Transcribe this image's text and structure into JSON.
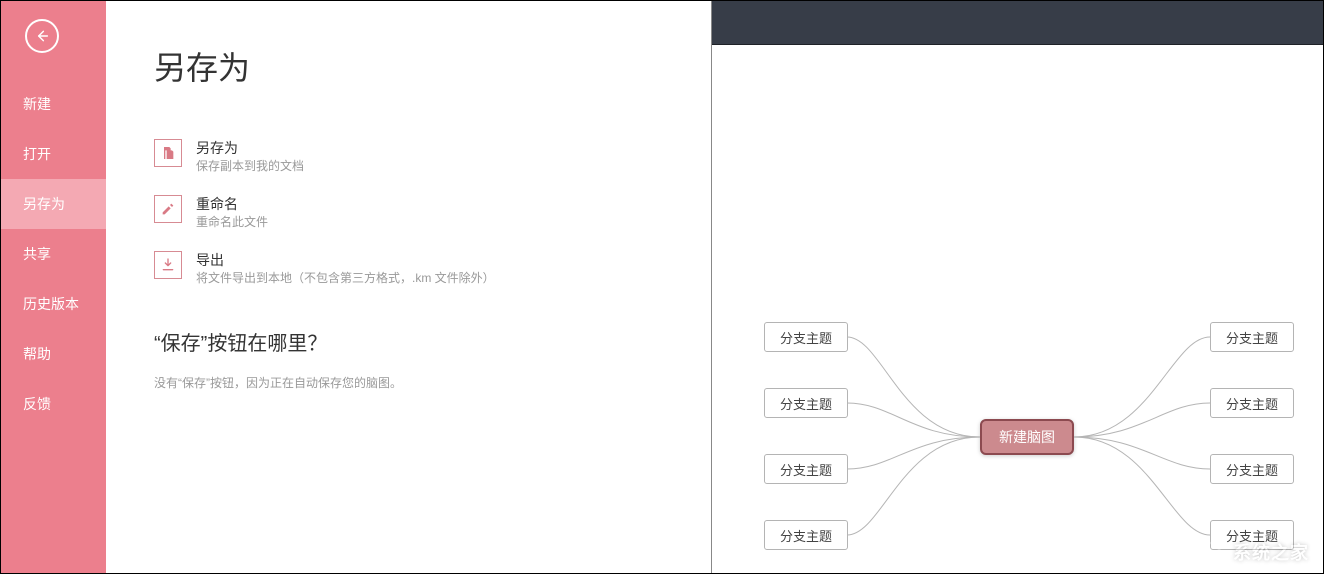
{
  "sidebar": {
    "items": [
      {
        "label": "新建"
      },
      {
        "label": "打开"
      },
      {
        "label": "另存为",
        "active": true
      },
      {
        "label": "共享"
      },
      {
        "label": "历史版本"
      },
      {
        "label": "帮助"
      },
      {
        "label": "反馈"
      }
    ]
  },
  "page": {
    "title": "另存为",
    "actions": [
      {
        "title": "另存为",
        "desc": "保存副本到我的文档"
      },
      {
        "title": "重命名",
        "desc": "重命名此文件"
      },
      {
        "title": "导出",
        "desc": "将文件导出到本地（不包含第三方格式，.km 文件除外）"
      }
    ],
    "section_title": "“保存”按钮在哪里？",
    "section_desc": "没有“保存”按钮，因为正在自动保存您的脑图。"
  },
  "mindmap": {
    "central": "新建脑图",
    "branches_left": [
      "分支主题",
      "分支主题",
      "分支主题",
      "分支主题"
    ],
    "branches_right": [
      "分支主题",
      "分支主题",
      "分支主题",
      "分支主题"
    ]
  },
  "watermark": {
    "text": "系统之家"
  },
  "icons": {
    "back": "back-arrow-icon",
    "save_as": "files-icon",
    "rename": "edit-icon",
    "export": "download-icon"
  }
}
